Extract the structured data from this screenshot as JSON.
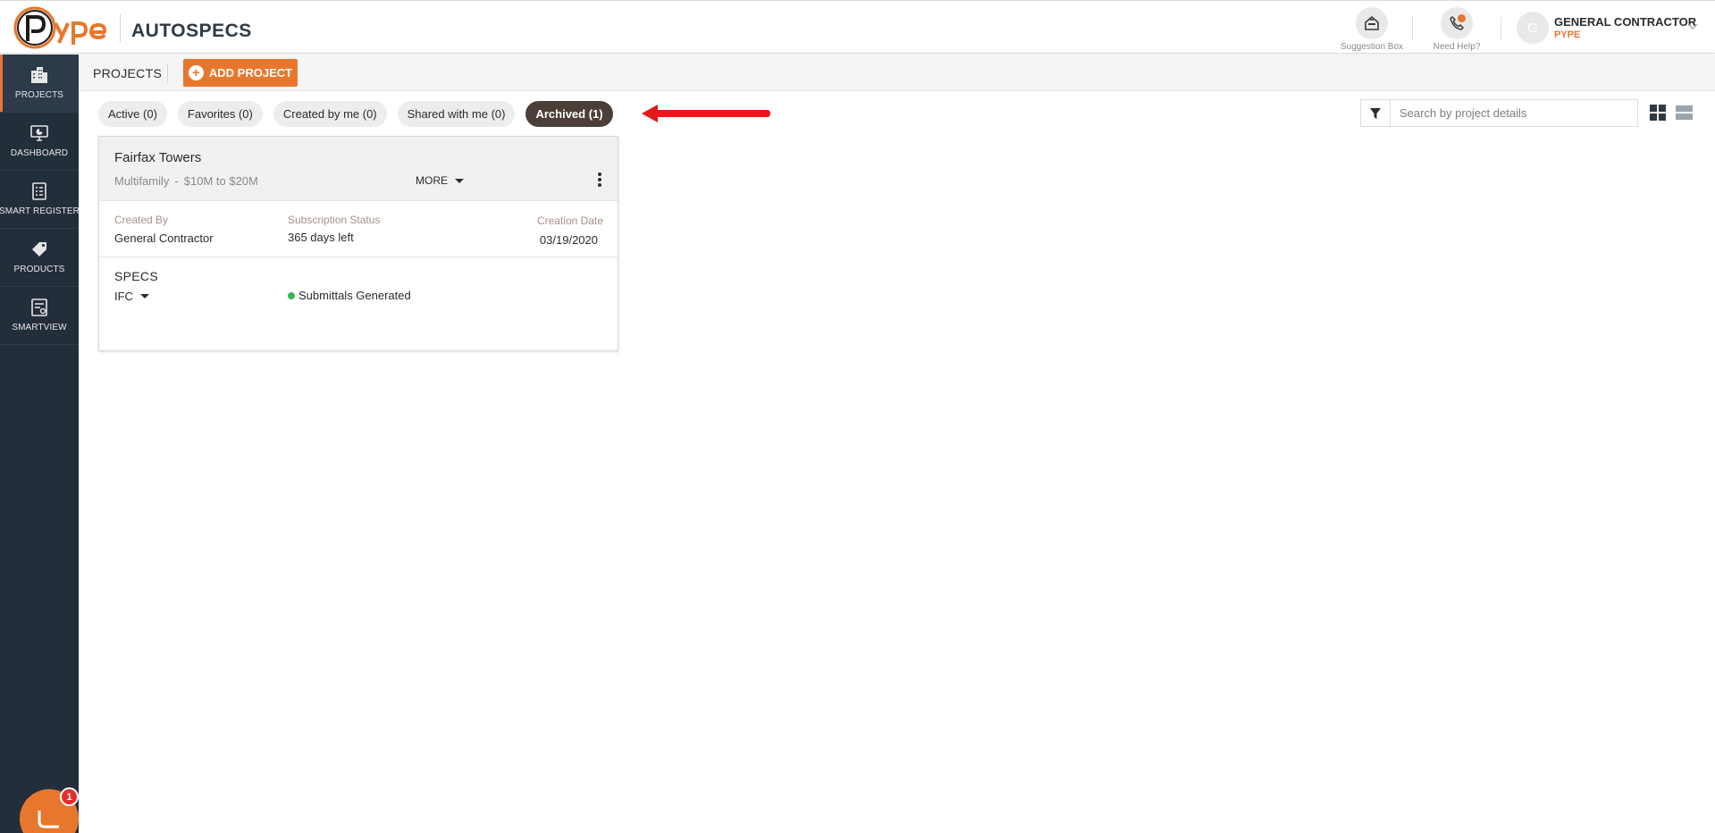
{
  "header": {
    "app_name": "AUTOSPECS",
    "logo_icon": "pype-logo",
    "tools": [
      {
        "label": "Suggestion Box",
        "icon": "suggestion-box-icon"
      },
      {
        "label": "Need Help?",
        "icon": "phone-help-icon"
      }
    ],
    "user": {
      "avatar_initial": "G",
      "name": "GENERAL CONTRACTOR",
      "org": "PYPE"
    }
  },
  "sidebar": {
    "items": [
      {
        "label": "PROJECTS",
        "icon": "buildings-icon",
        "active": true
      },
      {
        "label": "DASHBOARD",
        "icon": "monitor-chart-icon",
        "active": false
      },
      {
        "label": "SMART REGISTER",
        "icon": "register-list-icon",
        "active": false
      },
      {
        "label": "PRODUCTS",
        "icon": "tag-icon",
        "active": false
      },
      {
        "label": "SMARTVIEW",
        "icon": "smartview-icon",
        "active": false
      }
    ],
    "chat_badge": "1"
  },
  "subheader": {
    "title": "PROJECTS",
    "add_button": "ADD PROJECT"
  },
  "tabs": [
    {
      "label": "Active (0)",
      "selected": false
    },
    {
      "label": "Favorites (0)",
      "selected": false
    },
    {
      "label": "Created by me (0)",
      "selected": false
    },
    {
      "label": "Shared with me (0)",
      "selected": false
    },
    {
      "label": "Archived (1)",
      "selected": true
    }
  ],
  "search": {
    "placeholder": "Search by project details"
  },
  "project": {
    "name": "Fairfax Towers",
    "type": "Multifamily",
    "budget": "$10M to $20M",
    "more_label": "MORE",
    "created_by_label": "Created By",
    "created_by": "General Contractor",
    "subscription_label": "Subscription Status",
    "subscription": "365 days left",
    "creation_date_label": "Creation Date",
    "creation_date": "03/19/2020",
    "specs_title": "SPECS",
    "specs_type": "IFC",
    "specs_status": "Submittals Generated"
  },
  "colors": {
    "accent": "#e8772e",
    "sidebar_bg": "#232e3b",
    "selected_tab": "#4c3f38",
    "status_ok": "#35b84b",
    "annotation_arrow": "#e01b1b"
  }
}
